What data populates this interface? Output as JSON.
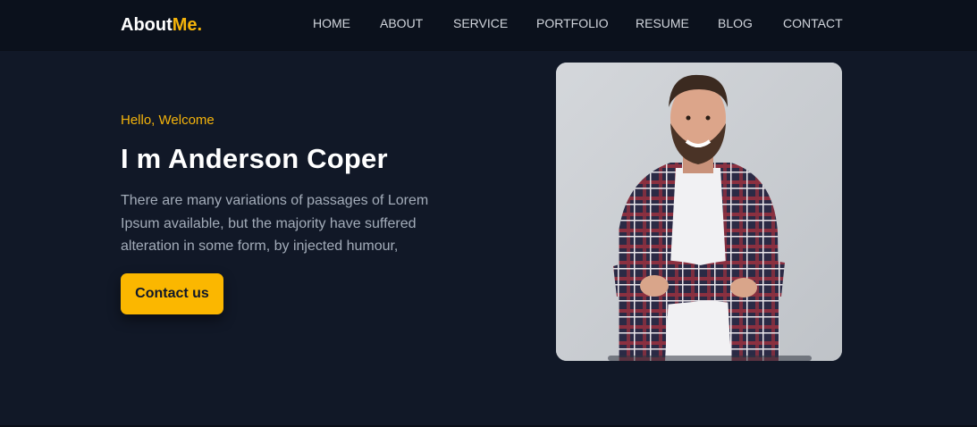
{
  "brand": {
    "name": "About",
    "accent": "Me."
  },
  "nav": {
    "items": [
      "HOME",
      "ABOUT",
      "SERVICE",
      "PORTFOLIO",
      "RESUME",
      "BLOG",
      "CONTACT"
    ]
  },
  "hero": {
    "greeting": "Hello, Welcome",
    "title": "I m Anderson Coper",
    "description": "There are many variations of passages of Lorem Ipsum available, but the majority have suffered alteration in some form, by injected humour,",
    "cta_label": "Contact us"
  },
  "colors": {
    "background": "#111827",
    "navbar": "#0b111c",
    "accent": "#f5b40b",
    "button": "#fbb700"
  },
  "icons": {
    "portrait": "person-portrait-photo"
  }
}
